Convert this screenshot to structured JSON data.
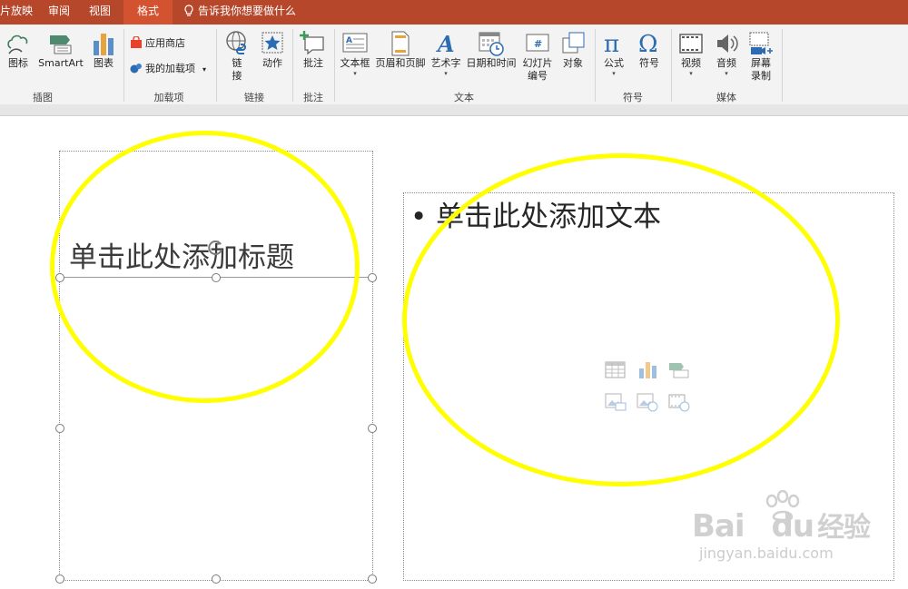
{
  "tabs": [
    {
      "label": "片放映",
      "active": false
    },
    {
      "label": "审阅",
      "active": false
    },
    {
      "label": "视图",
      "active": false
    },
    {
      "label": "格式",
      "active": true
    }
  ],
  "tell_me": "告诉我你想要做什么",
  "ribbon": {
    "groups": {
      "illustrations": {
        "label": "插图",
        "buttons": [
          "图标",
          "SmartArt",
          "图表"
        ]
      },
      "addins": {
        "label": "加载项",
        "store": "应用商店",
        "my_addins": "我的加载项"
      },
      "links": {
        "label": "链接",
        "link_line1": "链",
        "link_line2": "接",
        "action": "动作"
      },
      "comments": {
        "label": "批注",
        "comment": "批注"
      },
      "text": {
        "label": "文本",
        "textbox": "文本框",
        "header_footer": "页眉和页脚",
        "wordart": "艺术字",
        "datetime": "日期和时间",
        "slide_num_line1": "幻灯片",
        "slide_num_line2": "编号",
        "object": "对象"
      },
      "symbols": {
        "label": "符号",
        "equation": "公式",
        "symbol": "符号"
      },
      "media": {
        "label": "媒体",
        "video": "视频",
        "audio": "音频",
        "screen_line1": "屏幕",
        "screen_line2": "录制"
      }
    }
  },
  "slide": {
    "title_placeholder": "单击此处添加标题",
    "body_bullet": "•",
    "body_placeholder": "单击此处添加文本"
  },
  "annotation_color": "#ffff00",
  "accent": "#b7472a",
  "watermark": {
    "brand": "Bai",
    "brand2": "du",
    "cn": "经验",
    "url": "jingyan.baidu.com"
  }
}
